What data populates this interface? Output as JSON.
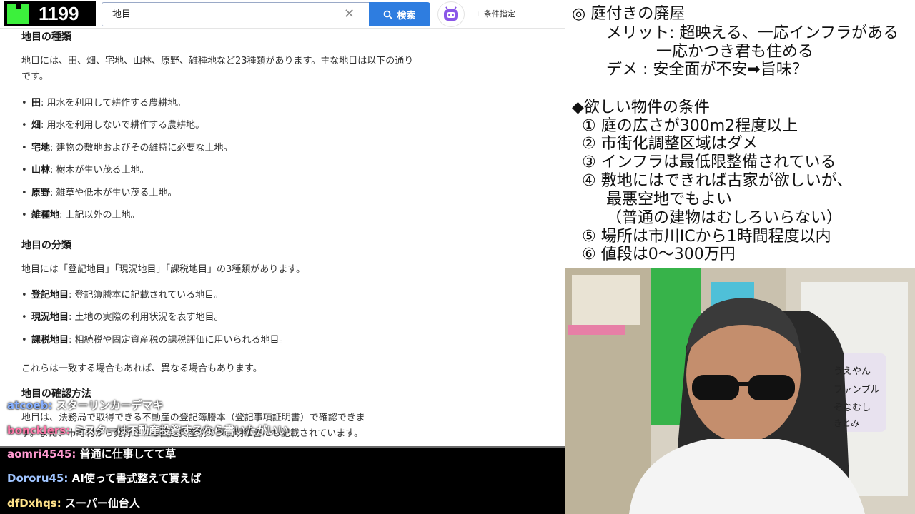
{
  "header": {
    "viewer_count": "1199",
    "search_value": "地目",
    "search_button": "検索",
    "condition_link": "+ 条件指定"
  },
  "article": {
    "section1_title": "地目の種類",
    "section1_intro": "地目には、田、畑、宅地、山林、原野、雑種地など23種類があります。主な地目は以下の通りです。",
    "types": [
      {
        "term": "田",
        "desc": ": 用水を利用して耕作する農耕地。"
      },
      {
        "term": "畑",
        "desc": ": 用水を利用しないで耕作する農耕地。"
      },
      {
        "term": "宅地",
        "desc": ": 建物の敷地およびその維持に必要な土地。"
      },
      {
        "term": "山林",
        "desc": ": 樹木が生い茂る土地。"
      },
      {
        "term": "原野",
        "desc": ": 雑草や低木が生い茂る土地。"
      },
      {
        "term": "雑種地",
        "desc": ": 上記以外の土地。"
      }
    ],
    "section2_title": "地目の分類",
    "section2_intro": "地目には「登記地目」「現況地目」「課税地目」の3種類があります。",
    "classes": [
      {
        "term": "登記地目",
        "desc": ": 登記簿謄本に記載されている地目。"
      },
      {
        "term": "現況地目",
        "desc": ": 土地の実際の利用状況を表す地目。"
      },
      {
        "term": "課税地目",
        "desc": ": 相続税や固定資産税の課税評価に用いられる地目。"
      }
    ],
    "note": "これらは一致する場合もあれば、異なる場合もあります。",
    "section3_title": "地目の確認方法",
    "section3_line1": "地目は、法務局で取得できる不動産の登記簿謄本（登記事項証明書）で確認できま",
    "section3_line2": "す。また、市町村から発行される固定資産税の課税明細書にも記載されています。"
  },
  "chat": [
    {
      "user": "atcoeb:",
      "message": "スターリンカーデマキ"
    },
    {
      "user": "boncklers:",
      "message": "ミスターは不動産投資するなら書いたがいい"
    },
    {
      "user": "aomri4545:",
      "message": "普通に仕事してて草"
    },
    {
      "user": "Dororu45:",
      "message": "AI使って書式整えて貰えば"
    },
    {
      "user": "dfDxhqs:",
      "message": "スーパー仙台人"
    }
  ],
  "notes": {
    "line1": "◎ 庭付きの廃屋",
    "line2": "メリット: 超映える、一応インフラがある",
    "line3": "一応かつき君も住める",
    "line4": "デメ : 安全面が不安➡旨味？",
    "line5": "◆欲しい物件の条件",
    "c1": "① 庭の広さが300m2程度以上",
    "c2": "② 市街化調整区域はダメ",
    "c3": "③ インフラは最低限整備されている",
    "c4a": "④ 敷地にはできれば古家が欲しいが、",
    "c4b": "最悪空地でもよい",
    "c4c": "（普通の建物はむしろいらない）",
    "c5": "⑤ 場所は市川ICから1時間程度以内",
    "c6": "⑥ 値段は0～300万円"
  },
  "webcam": {
    "name_cards": [
      "うえやん",
      "ファンブル",
      "ぞなむし",
      "きとみ"
    ]
  }
}
